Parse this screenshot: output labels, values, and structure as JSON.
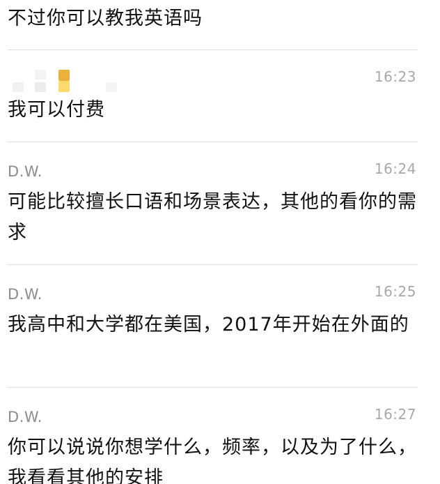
{
  "messages": [
    {
      "sender": "",
      "time": "",
      "text": "不过你可以教我英语吗"
    },
    {
      "sender": "",
      "time": "16:23",
      "text": "我可以付费"
    },
    {
      "sender": "D.W.",
      "time": "16:24",
      "text": "可能比较擅长口语和场景表达，其他的看你的需求"
    },
    {
      "sender": "D.W.",
      "time": "16:25",
      "text": "我高中和大学都在美国，2017年开始在外面的"
    },
    {
      "sender": "D.W.",
      "time": "16:27",
      "text": "你可以说说你想学什么，频率，以及为了什么，我看看其他的安排"
    }
  ],
  "colors": {
    "sender": "#8c8c8c",
    "time": "#a8a8a8",
    "text": "#111111",
    "divider": "#e0e0e0",
    "avatar_accent": "#f2b53a"
  }
}
